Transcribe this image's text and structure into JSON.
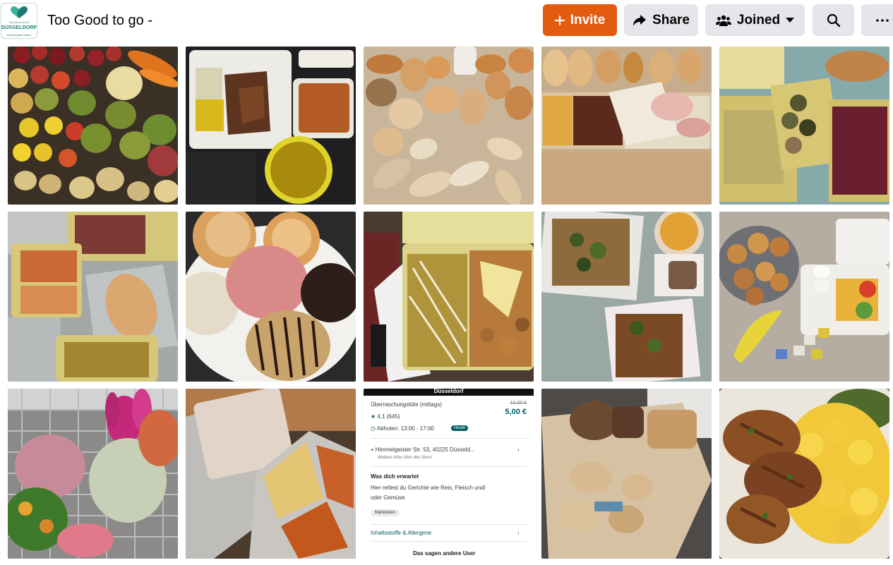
{
  "header": {
    "logo": {
      "line1": "Too Good To Go",
      "line2": "DÜSSELDORF",
      "line3": "Lebensmittel retten"
    },
    "title": "Too Good to go - ",
    "buttons": {
      "invite": "Invite",
      "share": "Share",
      "joined": "Joined"
    },
    "icons": [
      "plus-icon",
      "share-arrow-icon",
      "group-icon",
      "caret-down-icon",
      "search-icon",
      "more-icon"
    ],
    "accent_color": "#e35b0f",
    "button_bg": "#e4e6eb"
  },
  "photos": [
    "Fruit and vegetables",
    "Takeaway meal with rice and soup",
    "Bread rolls and pastries",
    "Deli trays with meat and sandwich",
    "Takeaway containers with salads",
    "Meal trays on foil",
    "Donuts",
    "Takeaway box with vegetables",
    "Salad boxes and soup",
    "Breakfast box with rolls and eggs",
    "Plants in shopping cart",
    "Aluminium trays with curry",
    "App screenshot",
    "Breads on paper bag",
    "Grilled chicken with potatoes"
  ],
  "app_screenshot": {
    "header": "Düsseldorf",
    "item_title": "Überraschungstüte (mittags)",
    "price_old": "10,00 €",
    "price": "5,00 €",
    "rating": "4,1 (645)",
    "pickup": "Abholen: 13:00 - 17:00",
    "pickup_badge": "Heute",
    "address": "Himmelgeister Str. 53, 40225 Düsseld...",
    "address_sub": "Weitere Infos über den Store",
    "section_title": "Was dich erwartet",
    "description_1": "Hier rettest du Gerichte wie Reis, Fleisch und/",
    "description_2": "oder Gemüse.",
    "tag": "Mahlzeiten",
    "ingredients_link": "Inhaltsstoffe & Allergene",
    "reviews_heading": "Das sagen andere User"
  }
}
